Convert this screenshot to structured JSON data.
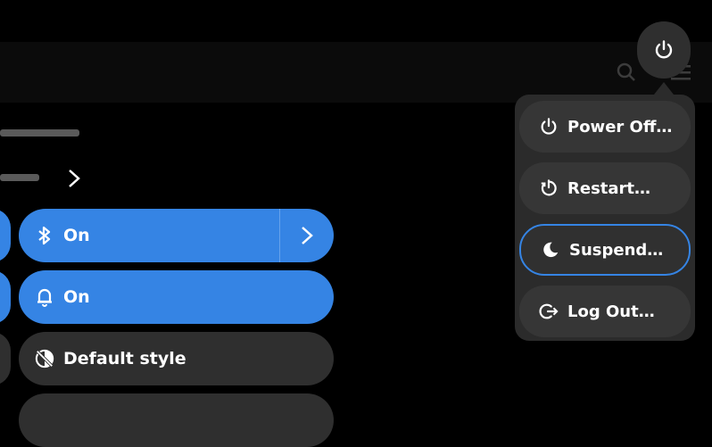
{
  "quick_settings": {
    "bluetooth": {
      "label": "On"
    },
    "notifications": {
      "label": "On"
    },
    "style": {
      "label": "Default style"
    }
  },
  "power_menu": {
    "items": [
      {
        "label": "Power Off…",
        "icon": "power-icon"
      },
      {
        "label": "Restart…",
        "icon": "restart-icon"
      },
      {
        "label": "Suspend…",
        "icon": "moon-icon"
      },
      {
        "label": "Log Out…",
        "icon": "logout-icon"
      }
    ]
  },
  "colors": {
    "accent": "#3584e4",
    "tile": "#2f2f2f",
    "menu": "#2b2b2b"
  }
}
